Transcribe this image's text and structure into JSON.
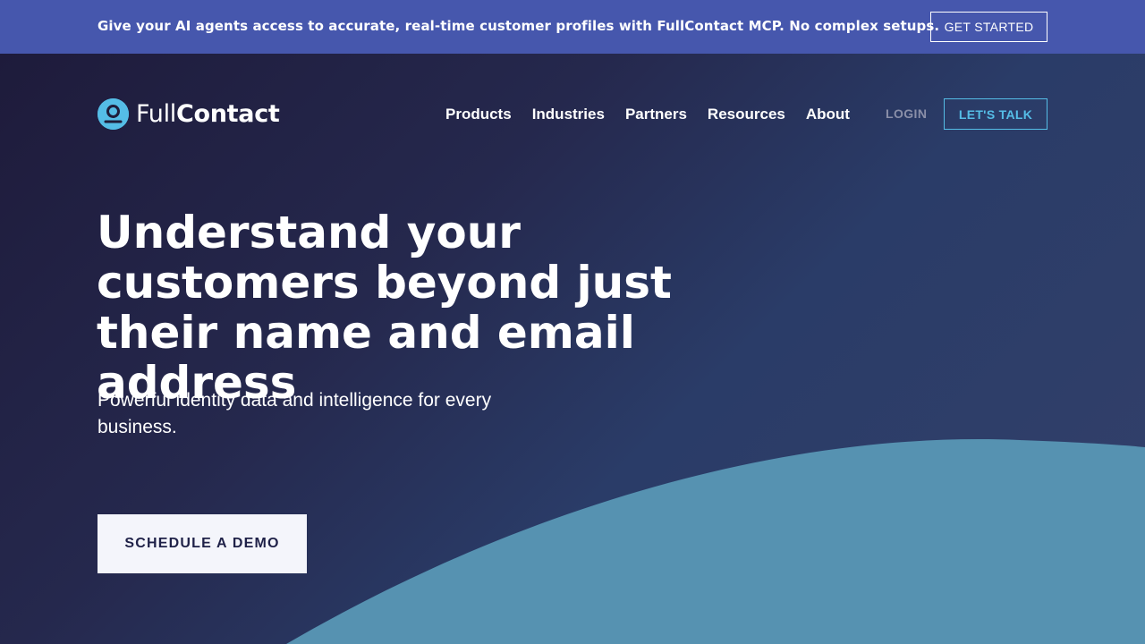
{
  "announcement": {
    "text": "Give your AI agents access to accurate, real-time customer profiles with FullContact MCP. No complex setups.",
    "cta_label": "GET STARTED"
  },
  "brand": {
    "name_light": "Full",
    "name_bold": "Contact",
    "logo_icon": "person-circle-icon"
  },
  "nav": {
    "items": [
      {
        "label": "Products"
      },
      {
        "label": "Industries"
      },
      {
        "label": "Partners"
      },
      {
        "label": "Resources"
      },
      {
        "label": "About"
      }
    ],
    "login_label": "LOGIN",
    "talk_label": "LET'S TALK"
  },
  "hero": {
    "headline": "Understand your customers beyond just their name and email address",
    "subhead": "Powerful identity data and intelligence for every business.",
    "cta_label": "SCHEDULE A DEMO"
  },
  "colors": {
    "announcement_bg": "#4657ad",
    "hero_bg": "#23264a",
    "accent": "#55bde6",
    "curve": "#5692b1"
  }
}
